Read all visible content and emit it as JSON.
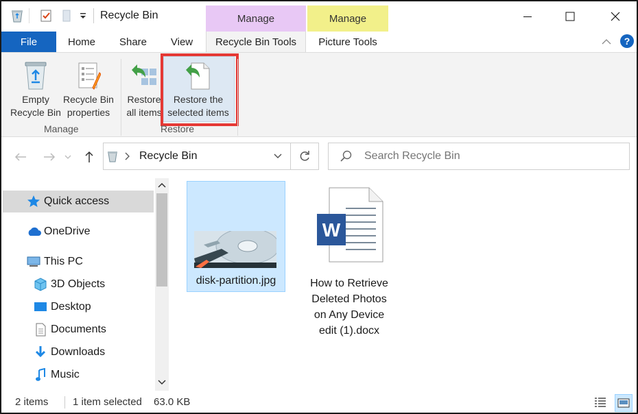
{
  "window": {
    "title": "Recycle Bin",
    "controls": {
      "minimize": "minimize-icon",
      "maximize": "maximize-icon",
      "close": "close-icon"
    }
  },
  "ribbon": {
    "context_groups": [
      {
        "label": "Manage",
        "color": "#e8c8f5"
      },
      {
        "label": "Manage",
        "color": "#f2f08a"
      }
    ],
    "tabs": {
      "file": "File",
      "home": "Home",
      "share": "Share",
      "view": "View",
      "recycle_tools": "Recycle Bin Tools",
      "picture_tools": "Picture Tools"
    },
    "buttons": {
      "empty_bin": [
        "Empty",
        "Recycle Bin"
      ],
      "bin_properties": [
        "Recycle Bin",
        "properties"
      ],
      "restore_all": [
        "Restore",
        "all items"
      ],
      "restore_selected": [
        "Restore the",
        "selected items"
      ]
    },
    "groups": {
      "manage": "Manage",
      "restore": "Restore"
    }
  },
  "address": {
    "location": "Recycle Bin"
  },
  "search": {
    "placeholder": "Search Recycle Bin"
  },
  "nav_pane": {
    "items": [
      {
        "label": "Quick access",
        "icon": "star-icon"
      },
      {
        "label": "OneDrive",
        "icon": "cloud-icon"
      },
      {
        "label": "This PC",
        "icon": "computer-icon"
      },
      {
        "label": "3D Objects",
        "icon": "cube-icon"
      },
      {
        "label": "Desktop",
        "icon": "desktop-icon"
      },
      {
        "label": "Documents",
        "icon": "documents-icon"
      },
      {
        "label": "Downloads",
        "icon": "download-icon"
      },
      {
        "label": "Music",
        "icon": "music-icon"
      }
    ]
  },
  "files": [
    {
      "name": "disk-partition.jpg",
      "selected": true
    },
    {
      "lines": [
        "How to Retrieve",
        "Deleted Photos",
        "on Any Device",
        "edit (1).docx"
      ],
      "selected": false
    }
  ],
  "status": {
    "count": "2 items",
    "selection": "1 item selected",
    "size": "63.0 KB"
  },
  "colors": {
    "accent": "#1565c0",
    "highlight": "#e53935",
    "selection": "#cce8ff"
  }
}
